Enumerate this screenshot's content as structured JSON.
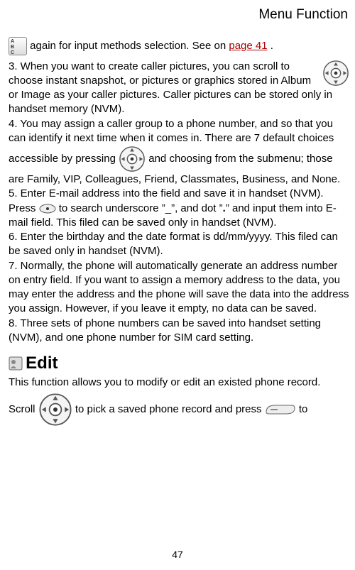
{
  "header": {
    "title": "Menu Function"
  },
  "body": {
    "line1a": " again for input methods selection. See on ",
    "link_page41": "page 41",
    "line1b": " .",
    "p3": "3. When you want to create caller pictures, you can scroll ",
    "p3b": "to choose instant snapshot, or pictures or graphics stored in Album or Image as your caller pictures. Caller pictures can be stored only in handset memory (NVM).",
    "p4a": "4. You may assign a caller group to a phone number, and so that you can identify it next time when it comes in. There are 7 default choices accessible by pressing ",
    "p4b": " and choosing from the submenu; those are Family, VIP, Colleagues, Friend, Classmates, Business, and None.",
    "p5": "5. Enter E-mail address into the field and save it in handset (NVM).",
    "p5press_a": "Press ",
    "p5press_b": " to search underscore ”_”, and dot ”",
    "p5press_c": "” and input them into E-mail field. This filed can be saved only in handset (NVM).",
    "dot_char": ".",
    "p6": "6. Enter the birthday and the date format is dd/mm/yyyy. This filed can be saved only in handset (NVM).",
    "p7": "7. Normally, the phone will automatically generate an address number on entry field. If you want to assign a memory address to the data, you may enter the address and the phone will save the data into the address you assign. However, if you leave it empty, no data can be saved.",
    "p8": "8. Three sets of phone numbers can be saved into handset setting (NVM), and one phone number for SIM card setting.",
    "edit_heading": "Edit",
    "edit_desc": "This function allows you to modify or edit an existed phone record.",
    "scroll_a": "Scroll ",
    "scroll_b": " to pick a saved phone record and press ",
    "scroll_c": " to"
  },
  "page_number": "47"
}
